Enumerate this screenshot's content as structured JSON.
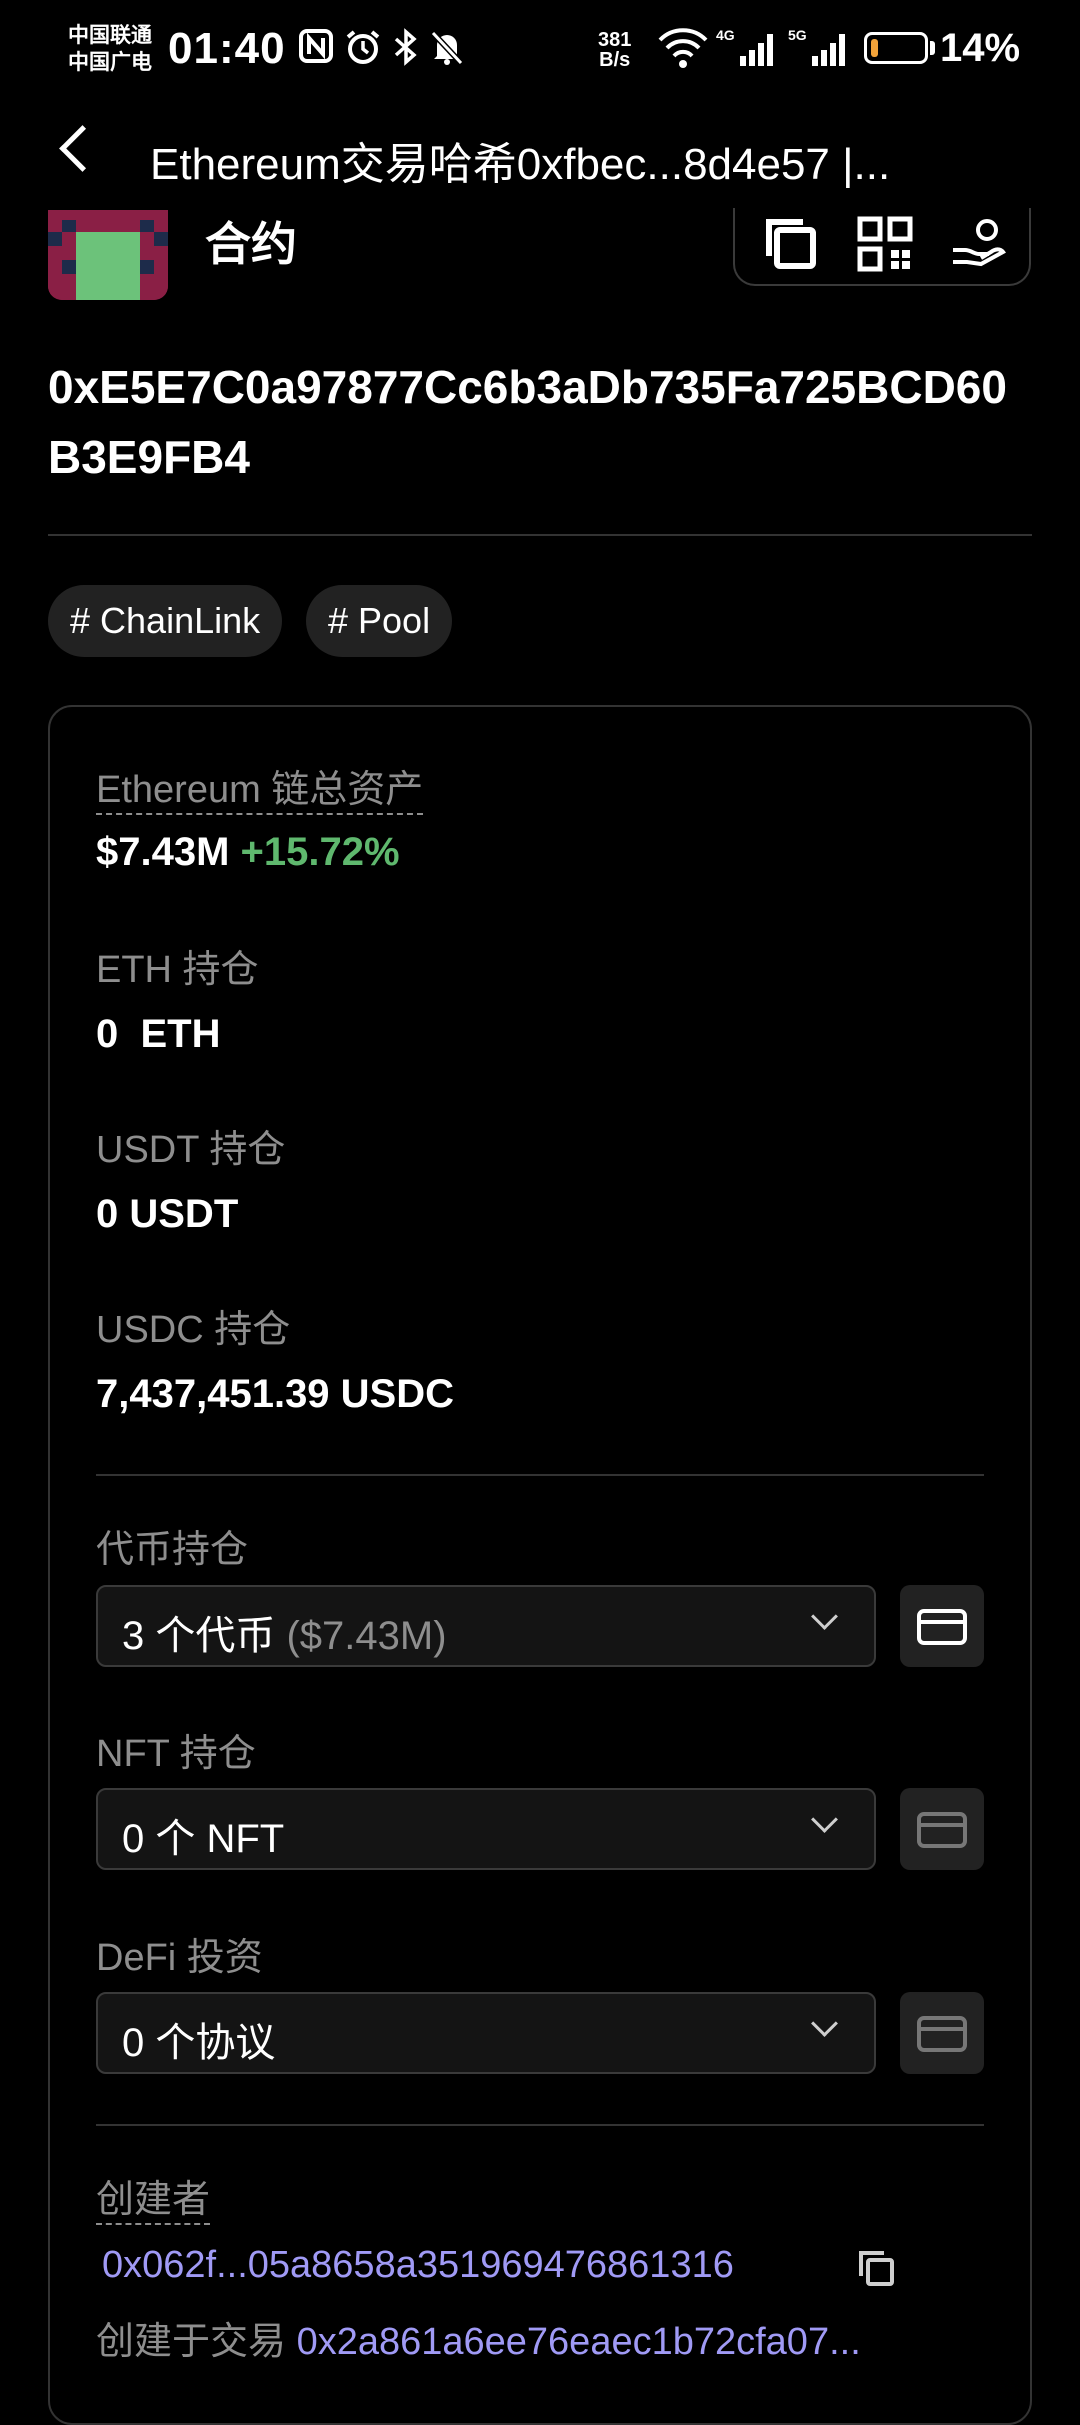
{
  "status_bar": {
    "carrier_1": "中国联通",
    "carrier_2": "中国广电",
    "time": "01:40",
    "net_speed_value": "381",
    "net_speed_unit": "B/s",
    "battery_percent": "14%",
    "battery_level": 0.14,
    "accent_battery": "#f2a33a"
  },
  "header": {
    "title": "Ethereum交易哈希0xfbec...8d4e57 |..."
  },
  "contract": {
    "type_label": "合约",
    "address": "0xE5E7C0a97877Cc6b3aDb735Fa725BCD60B3E9FB4",
    "actions": [
      "copy-icon",
      "qr-code-icon",
      "hand-coin-icon"
    ],
    "tags": [
      "# ChainLink",
      "# Pool"
    ]
  },
  "assets": {
    "total_label": "Ethereum 链总资产",
    "total_value": "$7.43M",
    "total_change": "+15.72%",
    "change_color": "#5fb86e",
    "holdings": [
      {
        "label": "ETH 持仓",
        "value": "0  ETH"
      },
      {
        "label": "USDT 持仓",
        "value": "0 USDT"
      },
      {
        "label": "USDC 持仓",
        "value": "7,437,451.39 USDC"
      }
    ]
  },
  "portfolio": {
    "tokens_label": "代币持仓",
    "tokens_value": "3 个代币",
    "tokens_sub": "($7.43M)",
    "nft_label": "NFT 持仓",
    "nft_value": "0 个 NFT",
    "defi_label": "DeFi 投资",
    "defi_value": "0 个协议"
  },
  "creator": {
    "label": "创建者",
    "address": "0x062f...05a8658a351969476861316",
    "created_in_label": "创建于交易",
    "tx_hash": "0x2a861a6ee76eaec1b72cfa07...",
    "link_color": "#a09af5"
  }
}
